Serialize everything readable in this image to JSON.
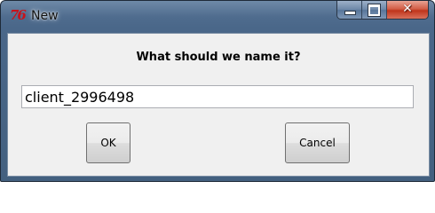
{
  "window": {
    "title": "New",
    "app_icon": "tk-feather-icon",
    "app_icon_glyph": "76",
    "caption": {
      "minimize_icon": "minimize-icon",
      "maximize_icon": "maximize-icon",
      "close_icon": "close-icon",
      "close_glyph": "✕"
    }
  },
  "dialog": {
    "prompt": "What should we name it?",
    "name_input": {
      "value": "client_2996498",
      "placeholder": ""
    },
    "ok_label": "OK",
    "cancel_label": "Cancel"
  },
  "colors": {
    "titlebar": "#4f6c8e",
    "client_bg": "#f0f0f0",
    "close_button": "#c0351c"
  }
}
